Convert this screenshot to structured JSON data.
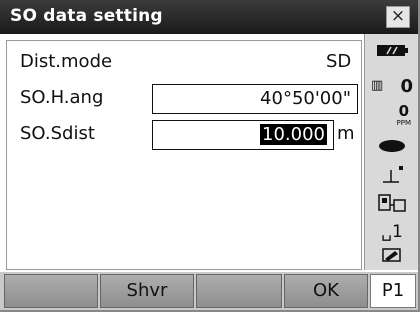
{
  "window": {
    "title": "SO data setting",
    "close_label": "×"
  },
  "rows": [
    {
      "label": "Dist.mode",
      "value": "SD"
    },
    {
      "label": "SO.H.ang",
      "value": "40°50'00\""
    },
    {
      "label": "SO.Sdist",
      "value": "10.000",
      "unit": "m"
    }
  ],
  "status": {
    "battery_icon": "battery-icon",
    "prism_constant": "0",
    "ppm_value": "0",
    "ppm_label": "PPM",
    "target_icon": "prism-target-icon",
    "tilt_icon": "tilt-compensation-icon",
    "comm_icon": "communication-icon",
    "input_mode": "␣1",
    "memory_icon": "memory-card-icon"
  },
  "softkeys": [
    "",
    "Shvr",
    "",
    "OK",
    "P1"
  ]
}
